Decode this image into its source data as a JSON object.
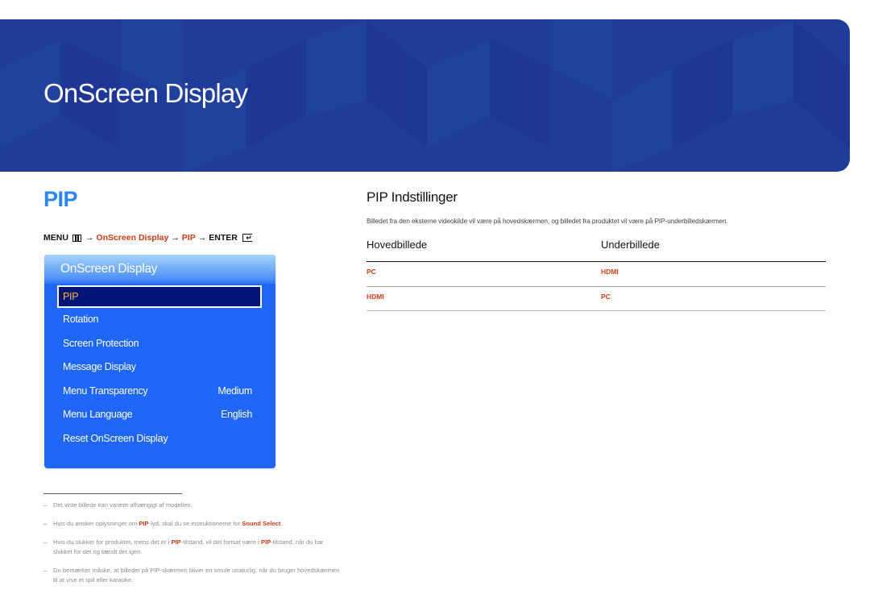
{
  "banner": {
    "title": "OnScreen Display"
  },
  "section": {
    "title": "PIP",
    "menu_path": {
      "menu_label": "MENU",
      "menu_icon": "menu-icon",
      "arrow": "→",
      "step1": "OnScreen Display",
      "step2": "PIP",
      "enter_label": "ENTER",
      "enter_icon": "enter-icon"
    }
  },
  "osd": {
    "title": "OnScreen Display",
    "items": [
      {
        "label": "PIP",
        "value": "",
        "selected": true
      },
      {
        "label": "Rotation",
        "value": ""
      },
      {
        "label": "Screen Protection",
        "value": ""
      },
      {
        "label": "Message Display",
        "value": ""
      },
      {
        "label": "Menu Transparency",
        "value": "Medium"
      },
      {
        "label": "Menu Language",
        "value": "English"
      },
      {
        "label": "Reset OnScreen Display",
        "value": ""
      }
    ]
  },
  "settings": {
    "title": "PIP Indstillinger",
    "description": "Billedet fra den eksterne videokilde vil være på hovedskærmen, og billedet fra produktet vil være på PIP-underbilledskærmen.",
    "columns": [
      "Hovedbillede",
      "Underbillede"
    ],
    "rows": [
      [
        "PC",
        "HDMI"
      ],
      [
        "HDMI",
        "PC"
      ]
    ]
  },
  "footnotes": {
    "note1": "Det viste billede kan variere afhængigt af modellen.",
    "note2": {
      "a": "Hvis du ønsker oplysninger om ",
      "b": "PIP",
      "c": "-lyd, skal du se instruktionerne for ",
      "d": "Sound Select",
      "e": "."
    },
    "note3": {
      "a": "Hvis du slukker for produktet, mens det er i ",
      "b": "PIP",
      "c": "-tilstand, vil det fortsat være i ",
      "d": "PIP",
      "e": "-tilstand, når du har slukket for det og tændt det igen."
    },
    "note4": "Du bemærker måske, at billedet på PIP-skærmen bliver en smule unaturlig, når du bruger hovedskærmen til at vise et spil eller karaoke."
  },
  "colors": {
    "accent_blue": "#2b86f0",
    "banner_blue": "#1e3c9a",
    "osd_blue": "#1f66fa",
    "osd_selected": "#001478",
    "highlight_red": "#d13a17",
    "selected_text": "#f7b53a"
  }
}
